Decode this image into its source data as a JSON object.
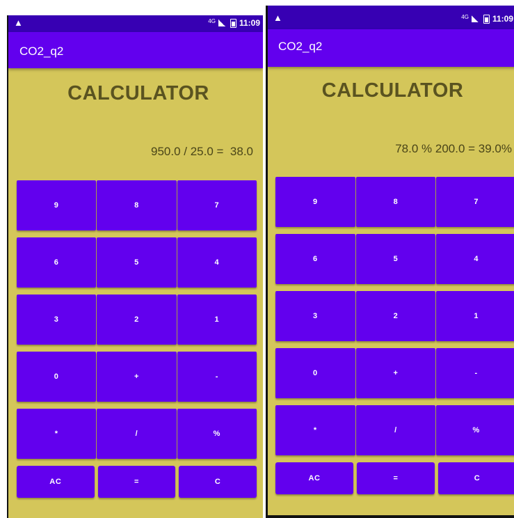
{
  "screens": [
    {
      "status": {
        "warning_glyph": "▲",
        "network": "4G",
        "time": "11:09"
      },
      "app_title": "CO2_q2",
      "heading": "CALCULATOR",
      "display": "950.0 / 25.0 =  38.0",
      "rows": [
        [
          "9",
          "8",
          "7"
        ],
        [
          "6",
          "5",
          "4"
        ],
        [
          "3",
          "2",
          "1"
        ],
        [
          "0",
          "+",
          "-"
        ],
        [
          "*",
          "/",
          "%"
        ]
      ],
      "bottom_row": [
        "AC",
        "=",
        "C"
      ]
    },
    {
      "status": {
        "warning_glyph": "▲",
        "network": "4G",
        "time": "11:09"
      },
      "app_title": "CO2_q2",
      "heading": "CALCULATOR",
      "display": "78.0 % 200.0 = 39.0%",
      "rows": [
        [
          "9",
          "8",
          "7"
        ],
        [
          "6",
          "5",
          "4"
        ],
        [
          "3",
          "2",
          "1"
        ],
        [
          "0",
          "+",
          "-"
        ],
        [
          "*",
          "/",
          "%"
        ]
      ],
      "bottom_row": [
        "AC",
        "=",
        "C"
      ]
    }
  ],
  "colors": {
    "status_bar": "#3700b3",
    "app_bar": "#6200ee",
    "background": "#d4c65a",
    "button": "#6200ee",
    "heading_text": "#5a5320"
  },
  "icons": {
    "warning": "warning-icon",
    "signal": "signal-icon",
    "battery": "battery-icon"
  }
}
